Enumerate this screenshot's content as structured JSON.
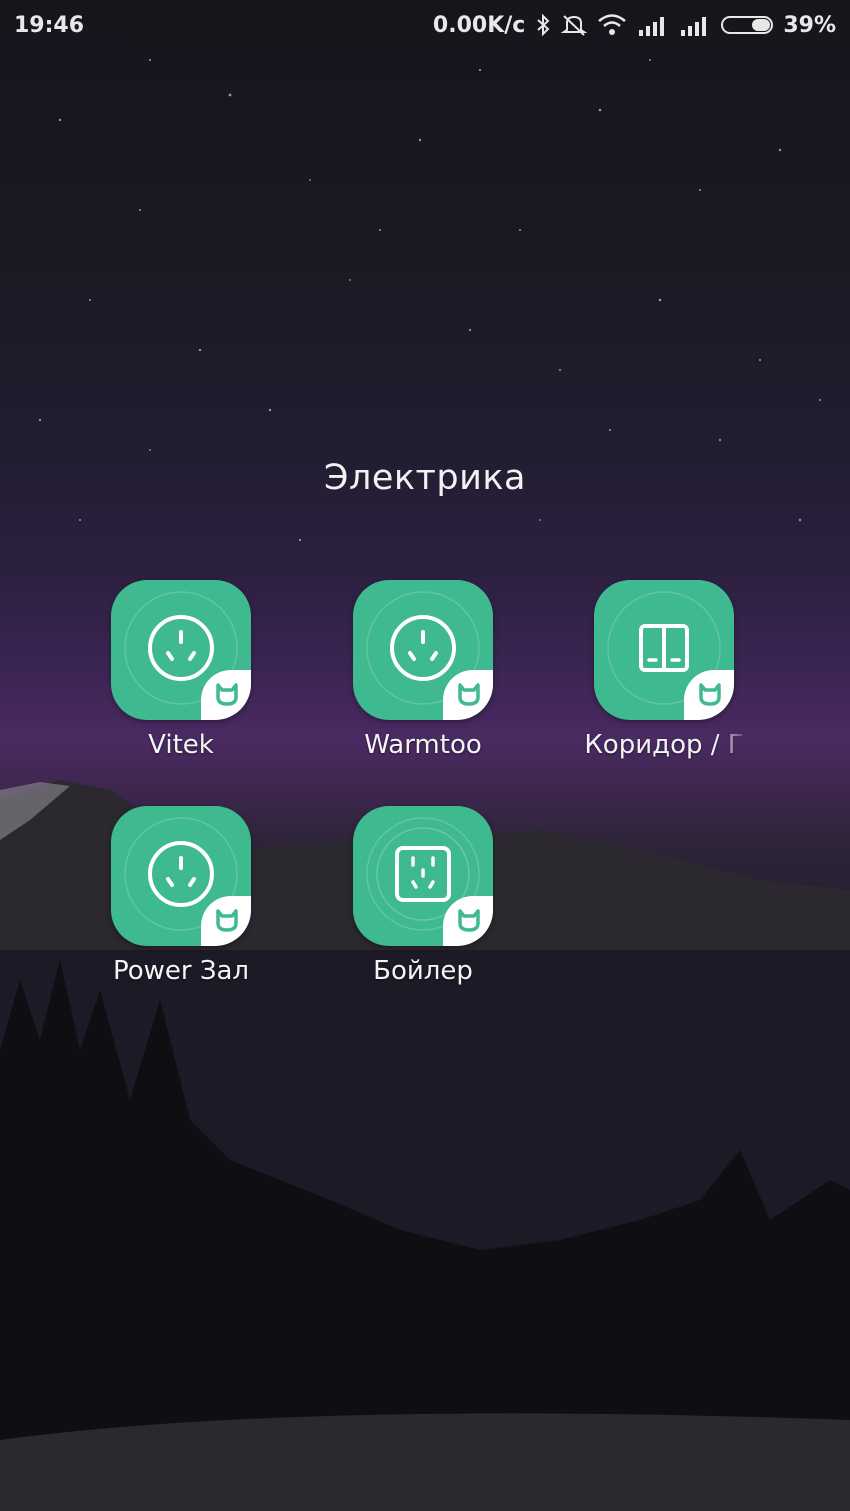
{
  "status_bar": {
    "time": "19:46",
    "network_speed": "0.00K/c",
    "battery_percent": "39%",
    "battery_level": 0.39,
    "icons": [
      "bluetooth-icon",
      "alarm-muted-icon",
      "wifi-icon",
      "signal-icon",
      "signal-icon",
      "battery-icon"
    ]
  },
  "folder": {
    "title": "Электрика",
    "apps": [
      {
        "label": "Vitek",
        "icon": "smart-plug-icon"
      },
      {
        "label": "Warmtoo",
        "icon": "smart-plug-icon"
      },
      {
        "label": "Коридор / Г",
        "icon": "wall-switch-icon"
      },
      {
        "label": "Power Зал",
        "icon": "smart-plug-icon"
      },
      {
        "label": "Бойлер",
        "icon": "wall-socket-icon"
      }
    ]
  },
  "colors": {
    "app_icon_bg": "#3fb98f",
    "badge_bg": "#ffffff"
  }
}
